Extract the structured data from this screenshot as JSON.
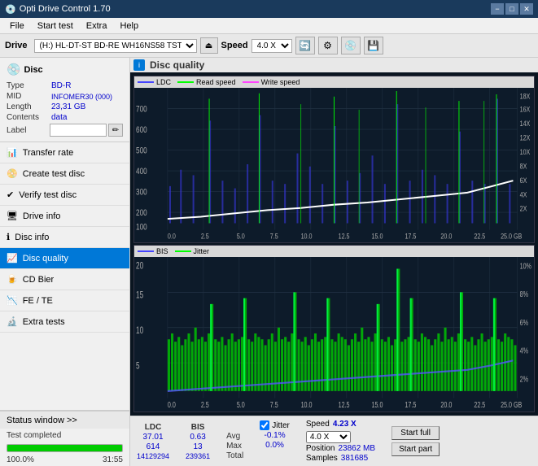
{
  "titlebar": {
    "title": "Opti Drive Control 1.70",
    "icon": "💿",
    "btn_min": "−",
    "btn_max": "□",
    "btn_close": "✕"
  },
  "menubar": {
    "items": [
      "File",
      "Start test",
      "Extra",
      "Help"
    ]
  },
  "toolbar": {
    "drive_label": "Drive",
    "drive_value": "(H:) HL-DT-ST BD-RE  WH16NS58 TST4",
    "speed_label": "Speed",
    "speed_value": "4.0 X"
  },
  "disc": {
    "header": "Disc",
    "type_label": "Type",
    "type_value": "BD-R",
    "mid_label": "MID",
    "mid_value": "INFOMER30 (000)",
    "length_label": "Length",
    "length_value": "23,31 GB",
    "contents_label": "Contents",
    "contents_value": "data",
    "label_label": "Label",
    "label_value": ""
  },
  "nav": {
    "items": [
      {
        "id": "transfer-rate",
        "label": "Transfer rate",
        "active": false
      },
      {
        "id": "create-test-disc",
        "label": "Create test disc",
        "active": false
      },
      {
        "id": "verify-test-disc",
        "label": "Verify test disc",
        "active": false
      },
      {
        "id": "drive-info",
        "label": "Drive info",
        "active": false
      },
      {
        "id": "disc-info",
        "label": "Disc info",
        "active": false
      },
      {
        "id": "disc-quality",
        "label": "Disc quality",
        "active": true
      },
      {
        "id": "cd-bier",
        "label": "CD Bier",
        "active": false
      },
      {
        "id": "fe-te",
        "label": "FE / TE",
        "active": false
      },
      {
        "id": "extra-tests",
        "label": "Extra tests",
        "active": false
      }
    ]
  },
  "status_window": {
    "label": "Status window >>",
    "status_text": "Test completed",
    "progress": 100,
    "progress_text": "100.0%",
    "time": "31:55"
  },
  "quality_panel": {
    "title": "Disc quality",
    "chart1": {
      "legend": [
        "LDC",
        "Read speed",
        "Write speed"
      ],
      "y_max": 700,
      "y_labels": [
        "700",
        "600",
        "500",
        "400",
        "300",
        "200",
        "100"
      ],
      "y_right": [
        "18X",
        "16X",
        "14X",
        "12X",
        "10X",
        "8X",
        "6X",
        "4X",
        "2X"
      ],
      "x_labels": [
        "0.0",
        "2.5",
        "5.0",
        "7.5",
        "10.0",
        "12.5",
        "15.0",
        "17.5",
        "20.0",
        "22.5",
        "25.0 GB"
      ]
    },
    "chart2": {
      "legend": [
        "BIS",
        "Jitter"
      ],
      "y_max": 20,
      "y_labels": [
        "20",
        "15",
        "10",
        "5"
      ],
      "y_right": [
        "10%",
        "8%",
        "6%",
        "4%",
        "2%"
      ],
      "x_labels": [
        "0.0",
        "2.5",
        "5.0",
        "7.5",
        "10.0",
        "12.5",
        "15.0",
        "17.5",
        "20.0",
        "22.5",
        "25.0 GB"
      ]
    }
  },
  "stats": {
    "ldc_label": "LDC",
    "bis_label": "BIS",
    "jitter_label": "Jitter",
    "speed_label": "Speed",
    "avg_label": "Avg",
    "max_label": "Max",
    "total_label": "Total",
    "ldc_avg": "37.01",
    "ldc_max": "614",
    "ldc_total": "14129294",
    "bis_avg": "0.63",
    "bis_max": "13",
    "bis_total": "239361",
    "jitter_avg": "-0.1%",
    "jitter_max": "0.0%",
    "jitter_check": true,
    "speed_value": "4.23 X",
    "speed_select": "4.0 X",
    "position_label": "Position",
    "position_value": "23862 MB",
    "samples_label": "Samples",
    "samples_value": "381685",
    "start_full_label": "Start full",
    "start_part_label": "Start part"
  }
}
